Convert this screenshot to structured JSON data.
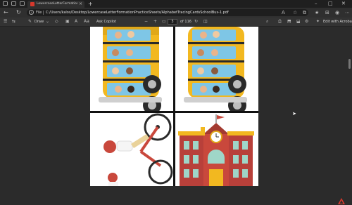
{
  "browser": {
    "tab_title": "LowercaseLetterFormationPracticeSheet...",
    "tab_close": "×",
    "new_tab": "+",
    "address_label": "File",
    "address_url": "C:/Users/kalos/Desktop/LowercaseLetterFormationPracticeSheets/AlphabetTracingCardsSchoolBus-1.pdf"
  },
  "pdf_toolbar": {
    "draw_label": "Draw",
    "ask_copilot": "Ask Copilot",
    "page_current": "3",
    "page_total": "of 116",
    "edit_with_acrobat": "Edit with Acrobat"
  },
  "icons": {
    "back": "back-arrow-icon",
    "refresh": "refresh-icon",
    "star": "star-icon",
    "menu": "more-icon",
    "acrobat": "acrobat-icon"
  },
  "colors": {
    "bus_yellow": "#f2b820",
    "school_red": "#c9483c",
    "acrobat_red": "#d6382c"
  }
}
